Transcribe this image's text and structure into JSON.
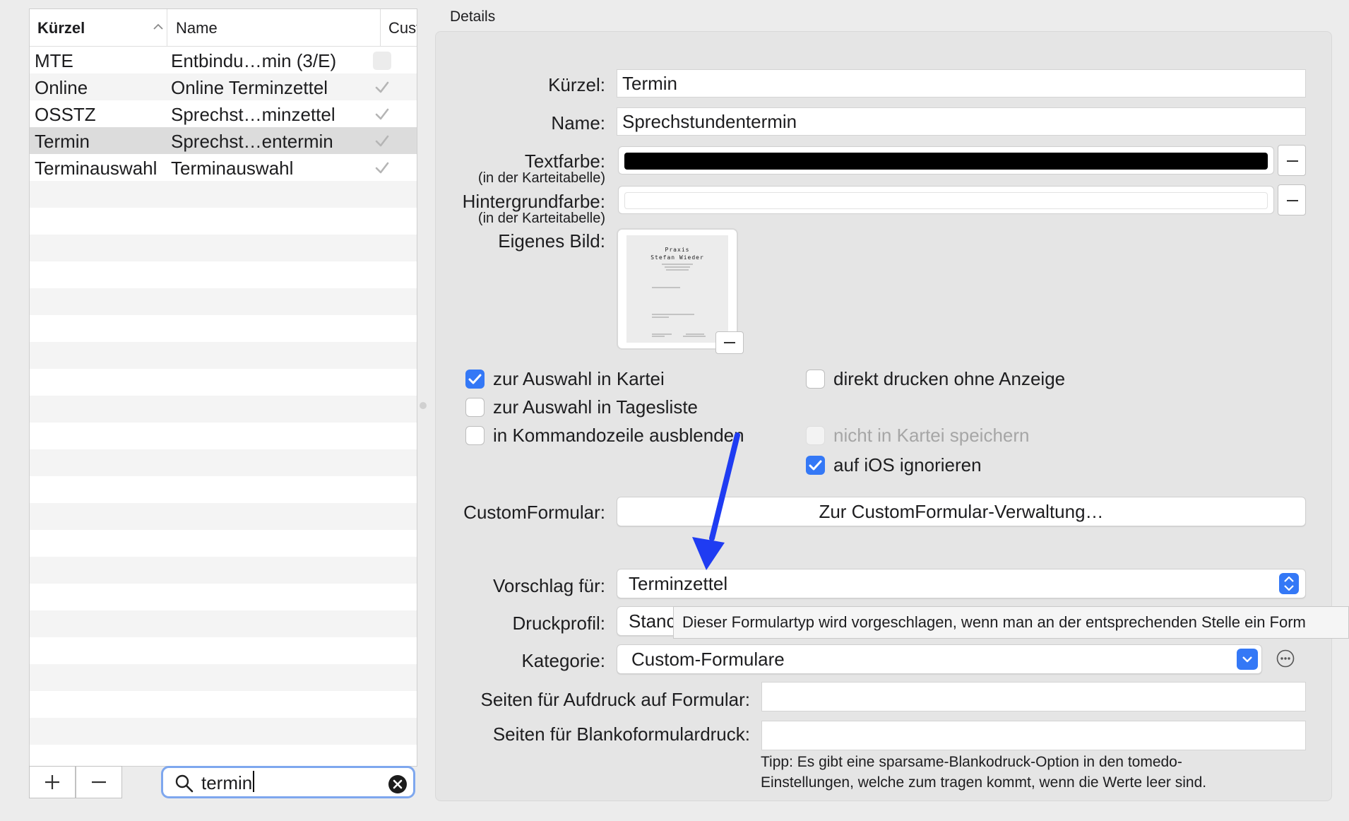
{
  "table": {
    "columns": [
      {
        "label": "Kürzel"
      },
      {
        "label": "Name"
      },
      {
        "label": "Cust…"
      }
    ],
    "rows": [
      {
        "kuerzel": "MTE",
        "name": "Entbindu…min (3/E)",
        "custom": false
      },
      {
        "kuerzel": "Online",
        "name": "Online Terminzettel",
        "custom": true
      },
      {
        "kuerzel": "OSSTZ",
        "name": "Sprechst…minzettel",
        "custom": true
      },
      {
        "kuerzel": "Termin",
        "name": "Sprechst…entermin",
        "custom": true,
        "selected": true
      },
      {
        "kuerzel": "Terminauswahl",
        "name": "Terminauswahl",
        "custom": true
      }
    ]
  },
  "search": {
    "value": "termin"
  },
  "details": {
    "title": "Details",
    "kuerzel_label": "Kürzel:",
    "kuerzel_value": "Termin",
    "name_label": "Name:",
    "name_value": "Sprechstundentermin",
    "textfarbe_label": "Textfarbe:",
    "textfarbe_sub": "(in der Karteitabelle)",
    "textfarbe_color": "#000000",
    "hintergrund_label": "Hintergrundfarbe:",
    "hintergrund_sub": "(in der Karteitabelle)",
    "hintergrund_color": "#ffffff",
    "bild_label": "Eigenes Bild:",
    "thumb": {
      "line1": "Praxis",
      "line2": "Stefan Wieder"
    },
    "checkboxes": [
      {
        "label": "zur Auswahl in Kartei",
        "checked": true,
        "disabled": false
      },
      {
        "label": "zur Auswahl in Tagesliste",
        "checked": false,
        "disabled": false
      },
      {
        "label": "in Kommandozeile ausblenden",
        "checked": false,
        "disabled": false
      },
      {
        "label": "direkt drucken ohne Anzeige",
        "checked": false,
        "disabled": false
      },
      {
        "label": "nicht in Kartei speichern",
        "checked": false,
        "disabled": true
      },
      {
        "label": "auf iOS ignorieren",
        "checked": true,
        "disabled": false
      }
    ],
    "customformular_label": "CustomFormular:",
    "customformular_button": "Zur CustomFormular-Verwaltung…",
    "vorschlag_label": "Vorschlag für:",
    "vorschlag_value": "Terminzettel",
    "druckprofil_label": "Druckprofil:",
    "druckprofil_value": "Stanc",
    "tooltip": "Dieser Formulartyp wird vorgeschlagen, wenn man an der entsprechenden Stelle ein Form",
    "kategorie_label": "Kategorie:",
    "kategorie_value": "Custom-Formulare",
    "seiten_aufdruck_label": "Seiten für Aufdruck auf Formular:",
    "seiten_aufdruck_value": "",
    "seiten_blanko_label": "Seiten für Blankoformulardruck:",
    "seiten_blanko_value": "",
    "tipp": "Tipp: Es gibt eine sparsame-Blankodruck-Option in den tomedo-Einstellungen, welche zum tragen kommt, wenn die Werte leer sind."
  },
  "colors": {
    "accent": "#3478f6",
    "annotation_arrow": "#1f3cf2",
    "selected_row": "#dcdcdc"
  }
}
